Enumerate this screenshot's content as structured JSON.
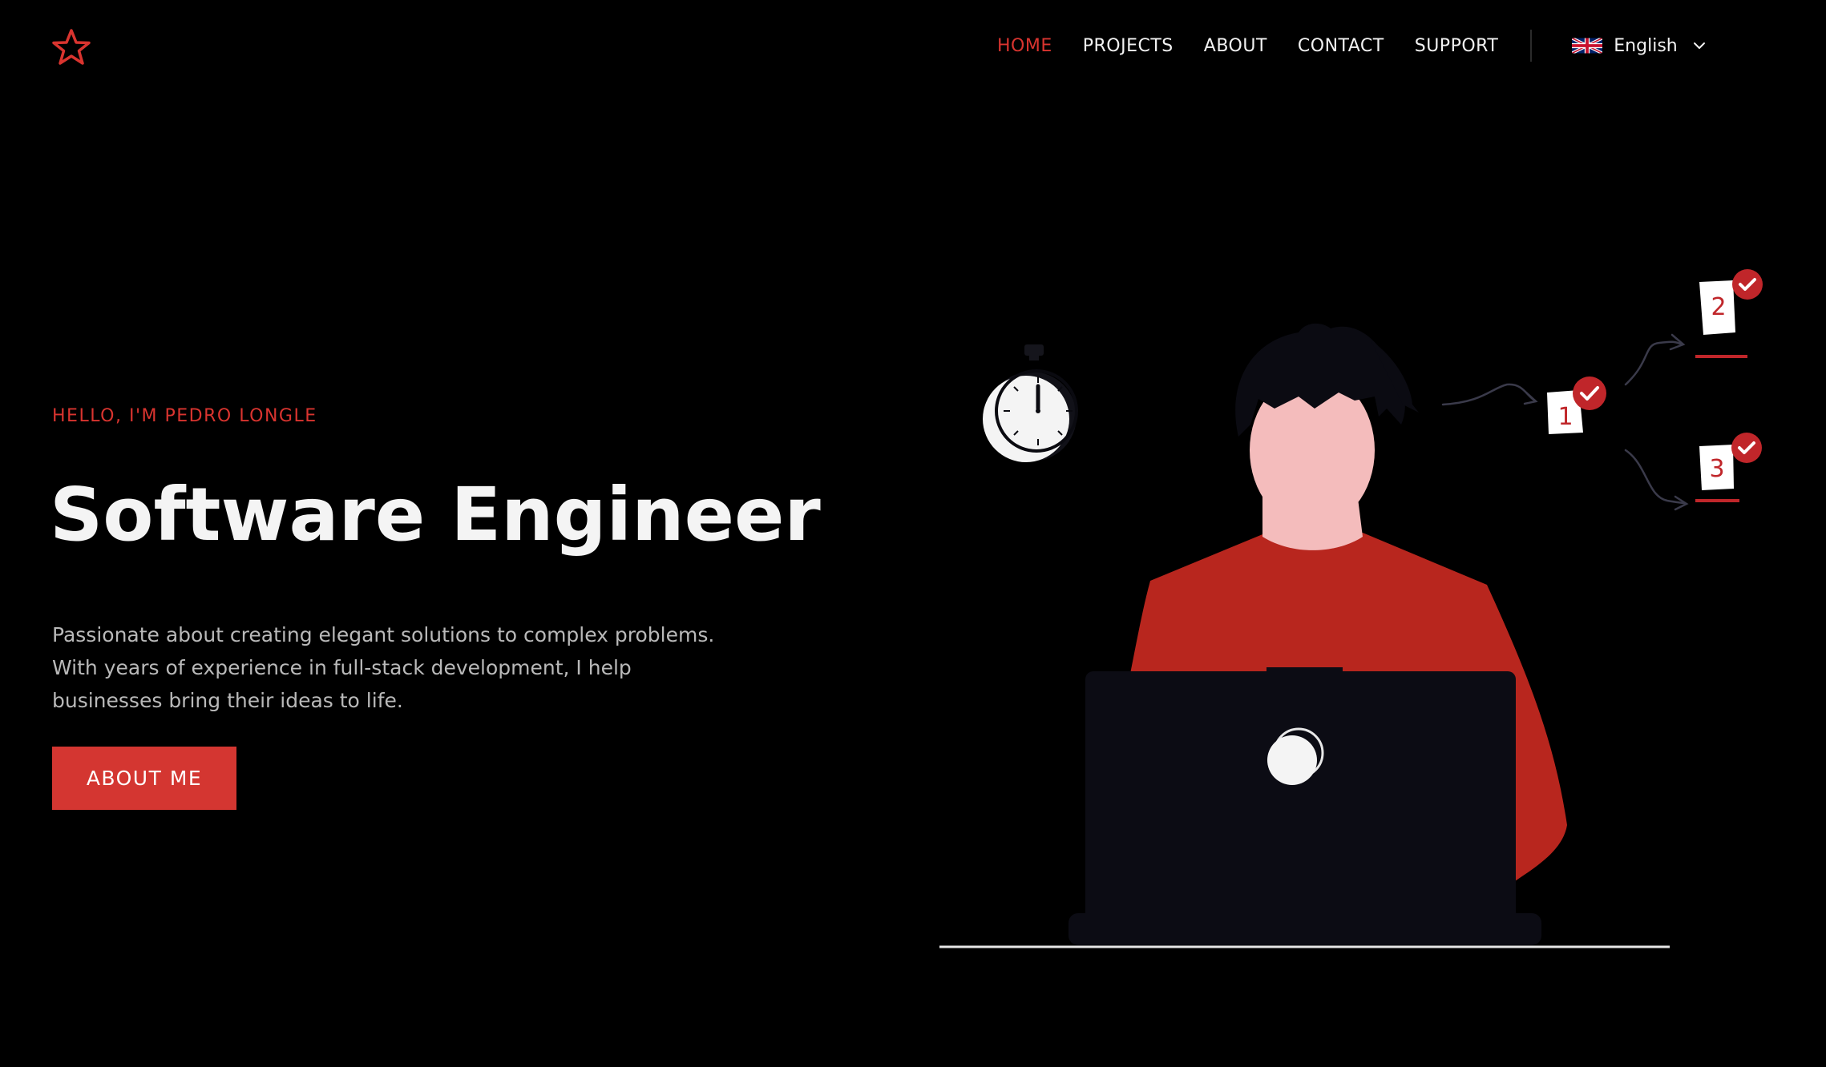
{
  "nav": {
    "items": [
      {
        "label": "HOME",
        "active": true
      },
      {
        "label": "PROJECTS",
        "active": false
      },
      {
        "label": "ABOUT",
        "active": false
      },
      {
        "label": "CONTACT",
        "active": false
      },
      {
        "label": "SUPPORT",
        "active": false
      }
    ],
    "language": {
      "selected": "English",
      "flag_icon": "uk-flag-icon",
      "dropdown_icon": "chevron-down-icon"
    },
    "logo_icon": "star-icon"
  },
  "hero": {
    "eyebrow": "HELLO, I'M PEDRO LONGLE",
    "title": "Software Engineer",
    "description": "Passionate about creating elegant solutions to complex problems. With years of experience in full-stack development, I help businesses bring their ideas to life.",
    "cta_label": "ABOUT ME"
  },
  "illustration": {
    "task_cards": [
      {
        "label": "1",
        "done": true
      },
      {
        "label": "2",
        "done": true
      },
      {
        "label": "3",
        "done": true
      }
    ],
    "icons": [
      "stopwatch-icon",
      "checkmark-icon",
      "laptop-icon",
      "person-illustration"
    ]
  },
  "colors": {
    "background": "#000000",
    "accent": "#d9342f",
    "text": "#f2f2f2",
    "muted_text": "#b9b9b9"
  }
}
